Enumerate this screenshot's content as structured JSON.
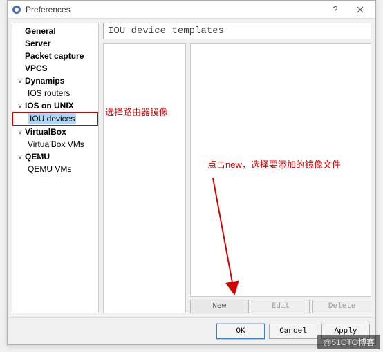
{
  "window": {
    "title": "Preferences"
  },
  "sidebar": {
    "items": [
      {
        "label": "General",
        "level": 0,
        "bold": true,
        "exp": ""
      },
      {
        "label": "Server",
        "level": 0,
        "bold": true,
        "exp": ""
      },
      {
        "label": "Packet capture",
        "level": 0,
        "bold": true,
        "exp": ""
      },
      {
        "label": "VPCS",
        "level": 0,
        "bold": true,
        "exp": ""
      },
      {
        "label": "Dynamips",
        "level": 0,
        "bold": true,
        "exp": "v"
      },
      {
        "label": "IOS routers",
        "level": 1,
        "bold": false,
        "exp": ""
      },
      {
        "label": "IOS on UNIX",
        "level": 0,
        "bold": true,
        "exp": "v"
      },
      {
        "label": "IOU devices",
        "level": 1,
        "bold": false,
        "exp": "",
        "selected": true
      },
      {
        "label": "VirtualBox",
        "level": 0,
        "bold": true,
        "exp": "v"
      },
      {
        "label": "VirtualBox VMs",
        "level": 1,
        "bold": false,
        "exp": ""
      },
      {
        "label": "QEMU",
        "level": 0,
        "bold": true,
        "exp": "v"
      },
      {
        "label": "QEMU VMs",
        "level": 1,
        "bold": false,
        "exp": ""
      }
    ]
  },
  "main": {
    "header": "IOU device templates"
  },
  "actions": {
    "new": "New",
    "edit": "Edit",
    "delete": "Delete"
  },
  "footer": {
    "ok": "OK",
    "cancel": "Cancel",
    "apply": "Apply"
  },
  "annotations": {
    "note1": "选择路由器镜像",
    "note2": "点击new，选择要添加的镜像文件"
  },
  "watermark": "@51CTO博客"
}
